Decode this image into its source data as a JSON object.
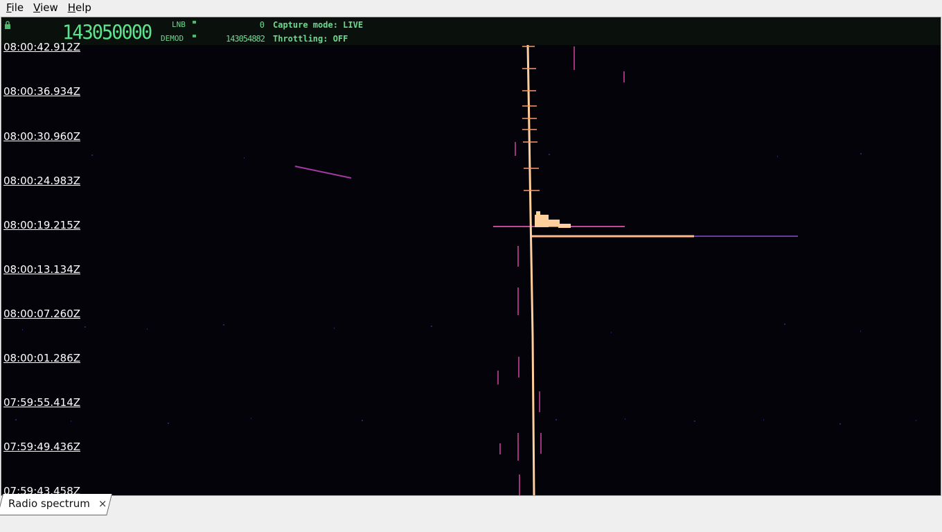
{
  "menu": {
    "file": {
      "mnemonic": "F",
      "rest": "ile"
    },
    "view": {
      "mnemonic": "V",
      "rest": "iew"
    },
    "help": {
      "mnemonic": "H",
      "rest": "elp"
    }
  },
  "header": {
    "main_frequency": "143050000",
    "lnb_label": "LNB",
    "lnb_value": "0",
    "demod_label": "DEMOD",
    "demod_value": "143054882",
    "capture_mode": "Capture mode: LIVE",
    "throttling": "Throttling: OFF"
  },
  "waterfall": {
    "timestamps": [
      "08:00:42.912Z",
      "08:00:36.934Z",
      "08:00:30.960Z",
      "08:00:24.983Z",
      "08:00:19.215Z",
      "08:00:13.134Z",
      "08:00:07.260Z",
      "08:00:01.286Z",
      "07:59:55.414Z",
      "07:59:49.436Z",
      "07:59:43.458Z"
    ]
  },
  "tabs": [
    {
      "label": "Radio spectrum",
      "close": "×"
    }
  ],
  "colors": {
    "background": "#05030a",
    "header_text": "#6fd88f",
    "signal_hot": "#ffcf9c",
    "signal_mid": "#e0508a",
    "signal_low": "#5a2c9a"
  }
}
